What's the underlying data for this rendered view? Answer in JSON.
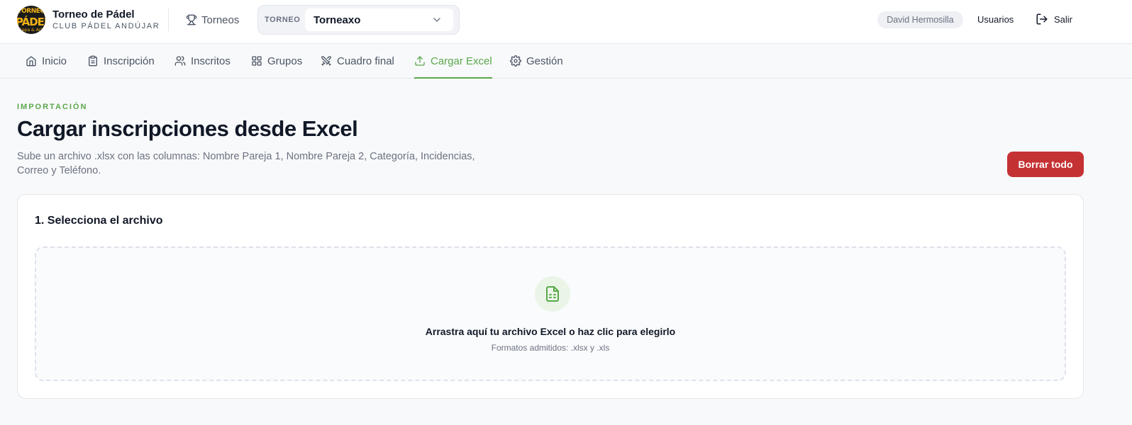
{
  "header": {
    "logo": {
      "line1": "TORNEO",
      "line2": "PÁDEL",
      "line3": "Cepa & Arit"
    },
    "brand_title": "Torneo de Pádel",
    "brand_subtitle": "CLUB PÁDEL ANDÚJAR",
    "torneos_link": "Torneos",
    "tournament_label": "TORNEO",
    "tournament_value": "Torneaxo",
    "user_name": "David Hermosilla",
    "users_link": "Usuarios",
    "logout_label": "Salir",
    "icons": {
      "torneos": "trophy-icon",
      "chevron": "chevron-down-icon",
      "logout": "logout-icon"
    }
  },
  "tabs": [
    {
      "label": "Inicio",
      "icon": "home-icon"
    },
    {
      "label": "Inscripción",
      "icon": "clipboard-icon"
    },
    {
      "label": "Inscritos",
      "icon": "users-icon"
    },
    {
      "label": "Grupos",
      "icon": "grid-icon"
    },
    {
      "label": "Cuadro final",
      "icon": "swords-icon"
    },
    {
      "label": "Cargar Excel",
      "icon": "upload-icon",
      "active": true
    },
    {
      "label": "Gestión",
      "icon": "gear-icon"
    }
  ],
  "page": {
    "kicker": "IMPORTACIÓN",
    "title": "Cargar inscripciones desde Excel",
    "description": "Sube un archivo .xlsx con las columnas: Nombre Pareja 1, Nombre Pareja 2, Categoría, Incidencias, Correo y Teléfono.",
    "delete_all_button": "Borrar todo"
  },
  "upload_card": {
    "title": "1. Selecciona el archivo",
    "dropzone_text": "Arrastra aquí tu archivo Excel o haz clic para elegirlo",
    "dropzone_hint": "Formatos admitidos: .xlsx y .xls",
    "icon": "file-spreadsheet-icon"
  },
  "colors": {
    "accent": "#5aa84b",
    "danger": "#c53234",
    "text": "#111827",
    "muted": "#6b7280",
    "logo_gold": "#f2b316"
  }
}
